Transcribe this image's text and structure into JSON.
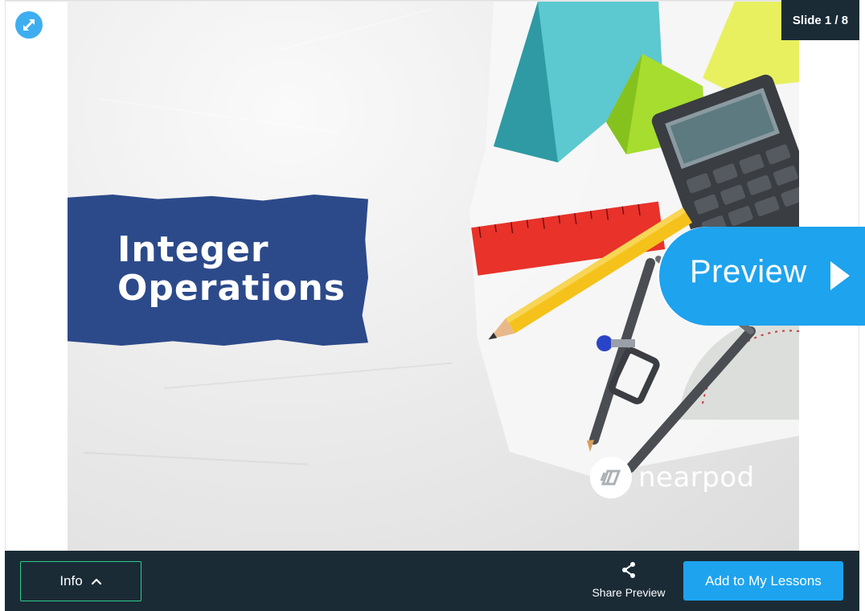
{
  "viewer": {
    "expand_icon": "expand-arrows-icon",
    "slide_counter": "Slide 1 / 8"
  },
  "slide": {
    "title": "Integer\nOperations",
    "logo_text": "nearpod",
    "colors": {
      "banner": "#2c4a8a",
      "paper": "#e6e6e6"
    }
  },
  "preview": {
    "label": "Preview",
    "icon": "play-triangle-icon",
    "color": "#1ea3ee"
  },
  "bottom_bar": {
    "info_label": "Info",
    "info_icon": "chevron-up-icon",
    "share_label": "Share Preview",
    "share_icon": "share-icon",
    "add_label": "Add to My Lessons",
    "colors": {
      "bar": "#1a2b36",
      "accent": "#1ea3ee",
      "info_border": "#2ecc8a"
    }
  }
}
